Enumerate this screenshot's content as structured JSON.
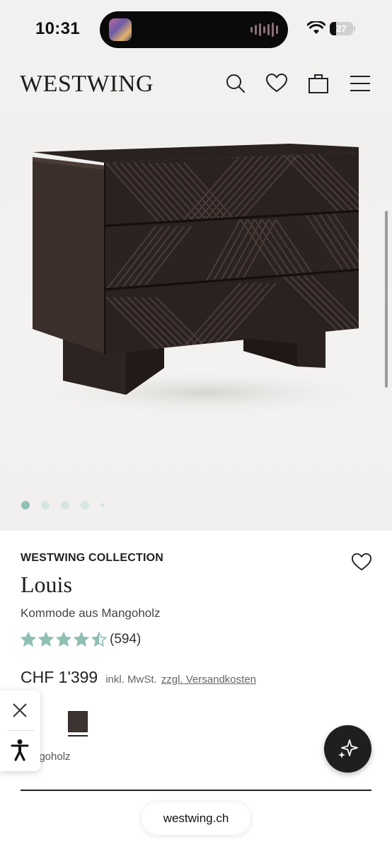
{
  "status_bar": {
    "time": "10:31",
    "battery_level": "27"
  },
  "header": {
    "logo": "WESTWING",
    "icons": [
      "search-icon",
      "heart-icon",
      "bag-icon",
      "menu-icon"
    ]
  },
  "gallery": {
    "image_count": 5,
    "active_index": 0
  },
  "product": {
    "brand": "WESTWING COLLECTION",
    "name": "Louis",
    "subtitle": "Kommode aus Mangoholz",
    "rating": 4.5,
    "review_count": "(594)",
    "price": "CHF 1'399",
    "vat_note": "inkl. MwSt.",
    "shipping_link": "zzgl. Versandkosten",
    "color_swatch": "#3e3432",
    "material_label": "ngoholz"
  },
  "colors": {
    "accent": "#8fc0b6",
    "star": "#8fbfb4",
    "dark_button": "#1f1f1f"
  },
  "browser": {
    "url": "westwing.ch"
  }
}
